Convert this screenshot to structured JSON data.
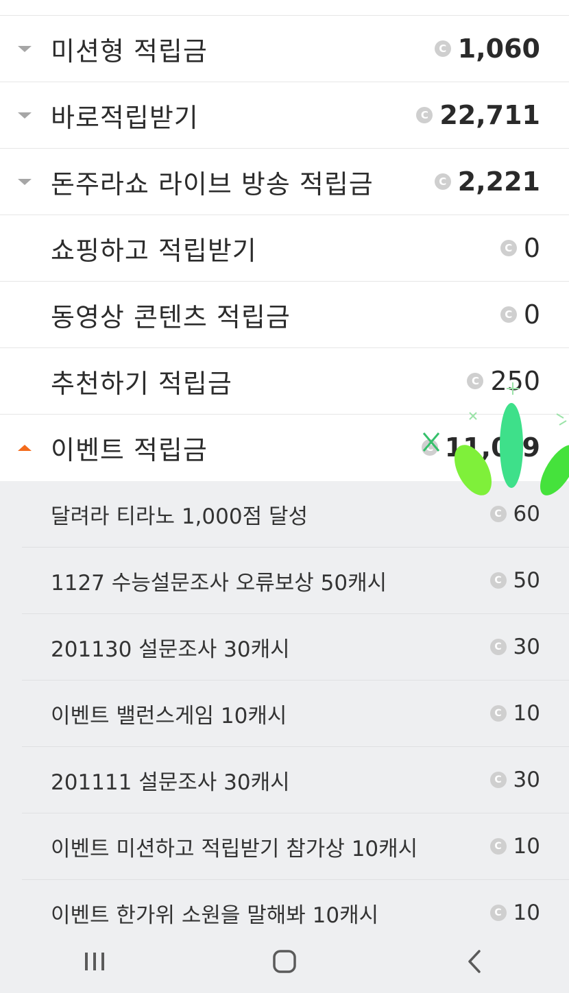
{
  "top_peek": "",
  "categories": [
    {
      "label": "미션형 적립금",
      "amount": "1,060",
      "state": "collapsed"
    },
    {
      "label": "바로적립받기",
      "amount": "22,711",
      "state": "collapsed"
    },
    {
      "label": "돈주라쇼 라이브 방송 적립금",
      "amount": "2,221",
      "state": "collapsed"
    },
    {
      "label": "쇼핑하고 적립받기",
      "amount": "0",
      "state": "none"
    },
    {
      "label": "동영상 콘텐츠 적립금",
      "amount": "0",
      "state": "none"
    },
    {
      "label": "추천하기 적립금",
      "amount": "250",
      "state": "none"
    },
    {
      "label": "이벤트 적립금",
      "amount": "11,0_9",
      "state": "expanded"
    }
  ],
  "event_items": [
    {
      "label": "달려라 티라노 1,000점 달성",
      "amount": "60"
    },
    {
      "label": "1127 수능설문조사 오류보상 50캐시",
      "amount": "50"
    },
    {
      "label": "201130 설문조사 30캐시",
      "amount": "30"
    },
    {
      "label": "이벤트 밸런스게임 10캐시",
      "amount": "10"
    },
    {
      "label": "201111 설문조사 30캐시",
      "amount": "30"
    },
    {
      "label": "이벤트 미션하고 적립받기 참가상 10캐시",
      "amount": "10"
    },
    {
      "label": "이벤트 한가위 소원을 말해봐 10캐시",
      "amount": "10"
    }
  ],
  "coin_glyph": "C",
  "icons": {
    "collapsed_arrow": "triangle-down-icon",
    "expanded_arrow": "triangle-up-icon",
    "coin": "cash-coin-icon"
  },
  "colors": {
    "expanded_arrow": "#f36b1c",
    "collapsed_arrow": "#a6a6a6",
    "sub_background": "#eeeff1",
    "sticker_green": "#3ee08a",
    "sticker_lime": "#7ff03a"
  },
  "nav": {
    "recents": "recent-apps-icon",
    "home": "home-icon",
    "back": "back-icon"
  }
}
